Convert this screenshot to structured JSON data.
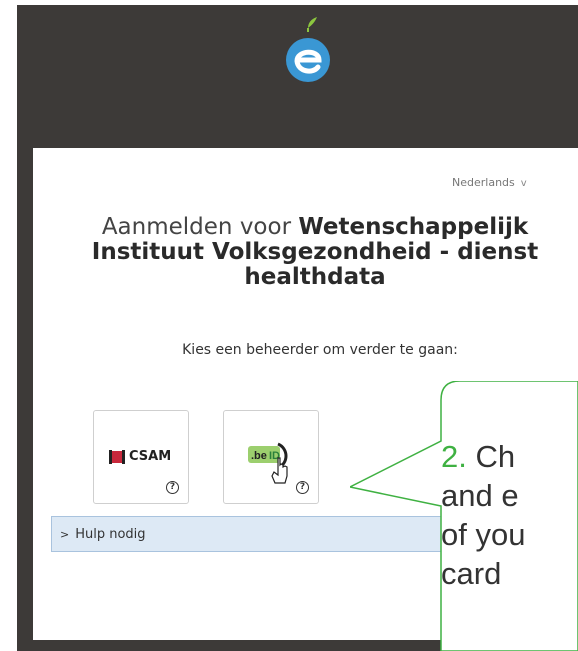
{
  "header": {
    "logo_icon": "e-leaf-logo-icon"
  },
  "language": {
    "selected": "Nederlands",
    "chevron": "v"
  },
  "title": {
    "prefix": "Aanmelden voor ",
    "line1_bold": "Wetenschappelijk",
    "line2": "Instituut Volksgezondheid - dienst",
    "line3": "healthdata"
  },
  "subtitle": "Kies een beheerder om verder te gaan:",
  "providers": [
    {
      "label": "CSAM",
      "icon": "csam-flag-icon",
      "help": "?"
    },
    {
      "label": ".beID",
      "icon": "beid-card-icon",
      "help": "?"
    }
  ],
  "help": {
    "chevron": ">",
    "label": "Hulp nodig"
  },
  "callout": {
    "number": "2.",
    "line1": "Ch",
    "line2": "and e",
    "line3": "of you",
    "line4": "card"
  },
  "colors": {
    "frame": "#3d3a38",
    "accent": "#3fb142",
    "help_bar": "#dde9f5"
  }
}
